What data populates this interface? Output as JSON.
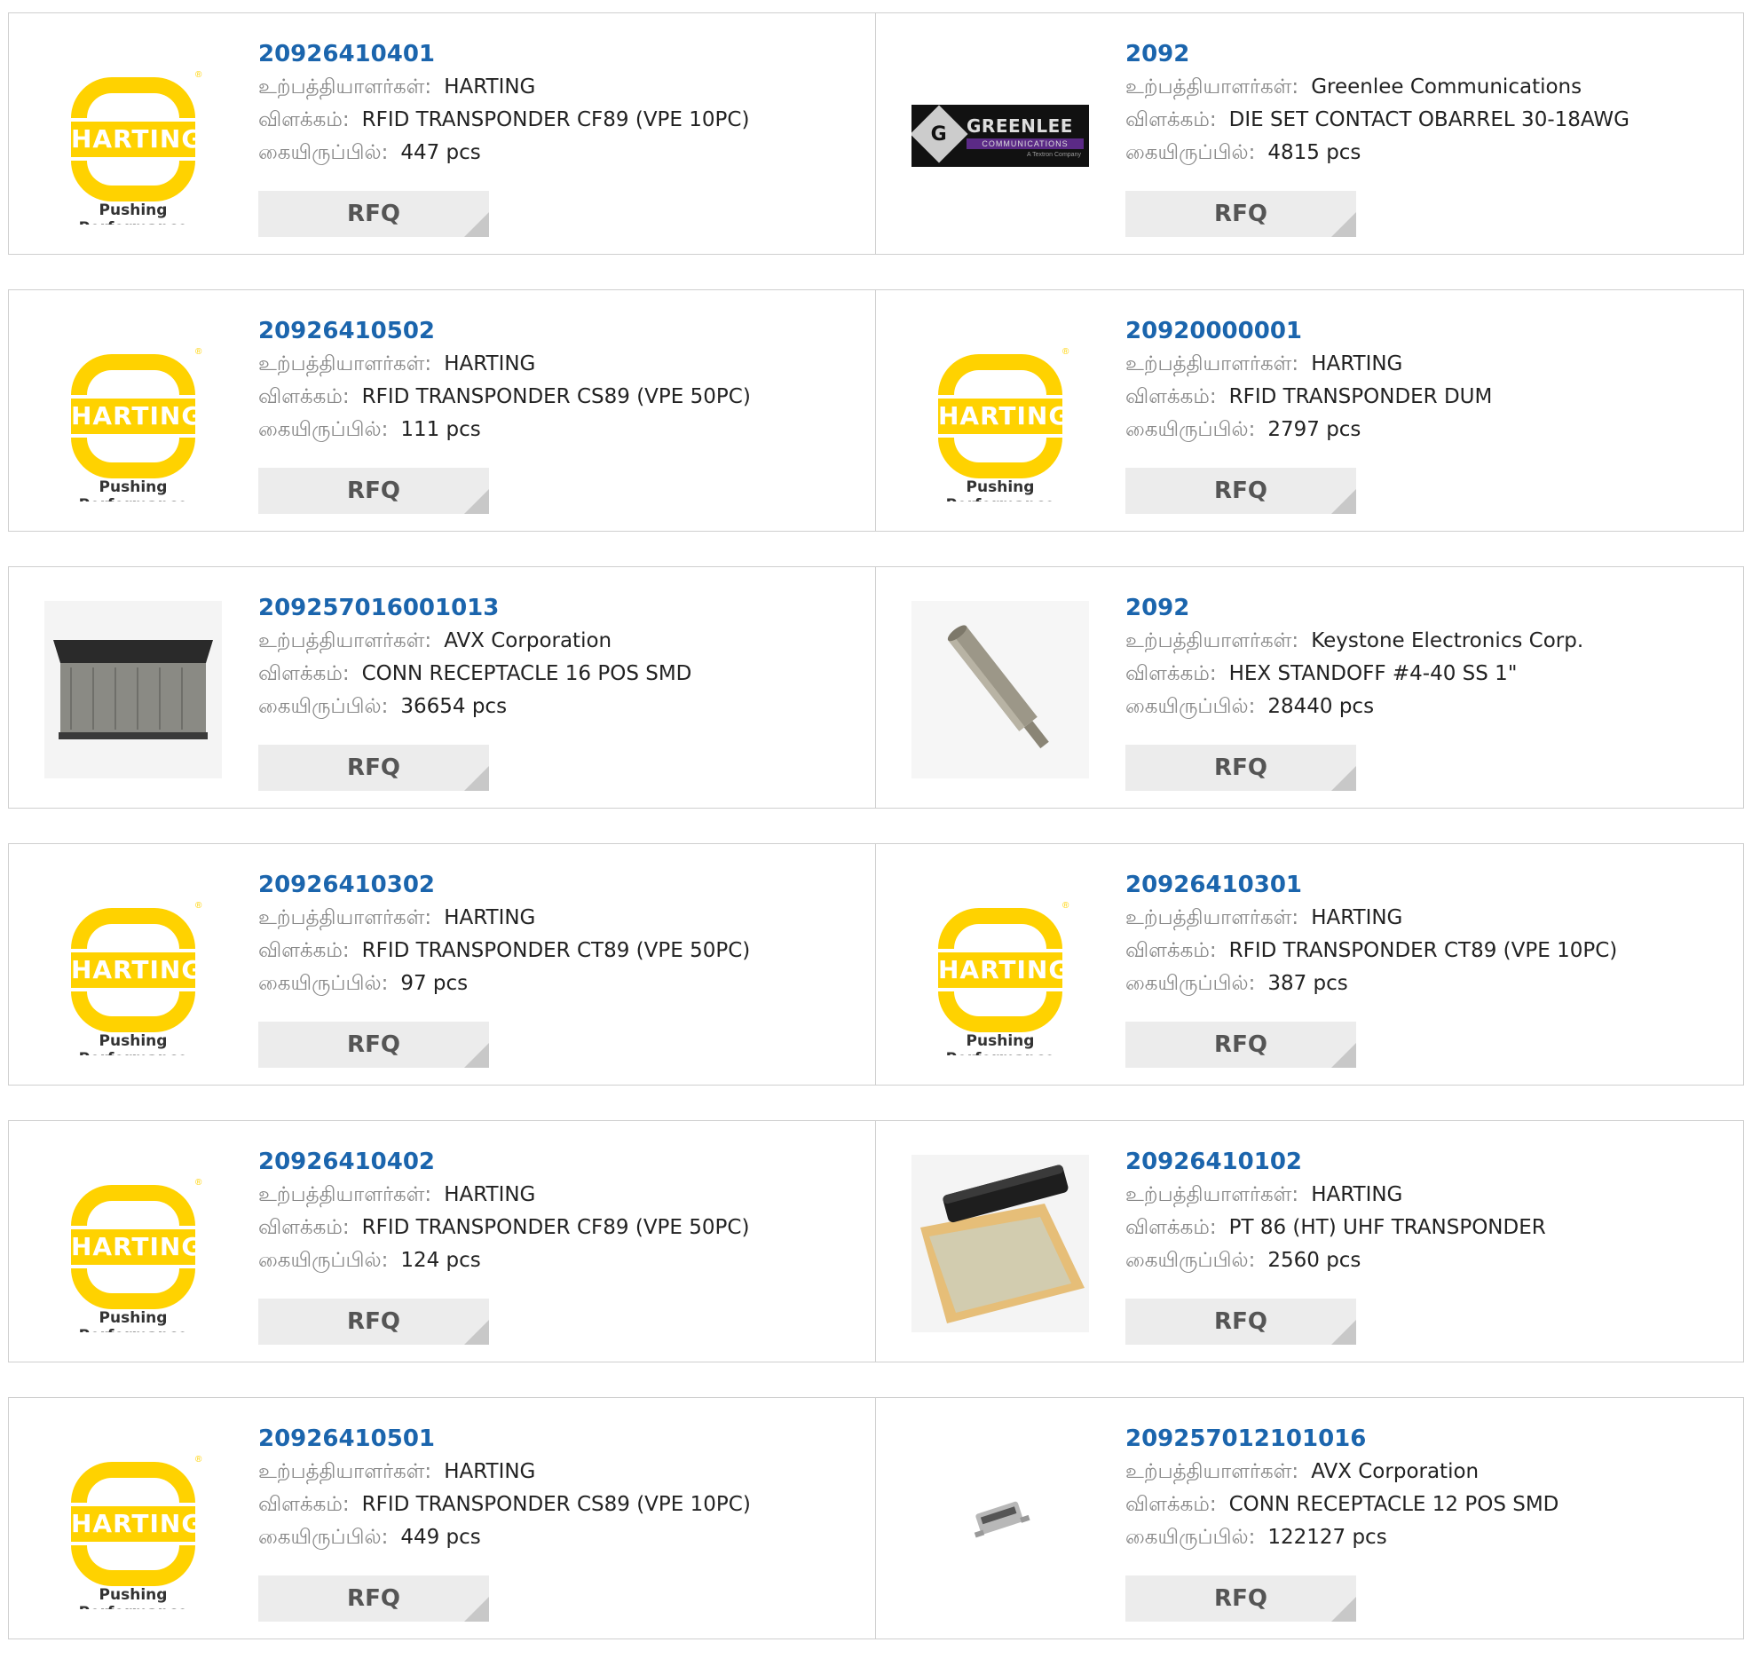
{
  "labels": {
    "manufacturer": "உற்பத்தியாளர்கள்:",
    "description": "விளக்கம்:",
    "stock": "கையிருப்பில்:",
    "rfq": "RFQ"
  },
  "logos": {
    "harting_wordmark": "HARTING",
    "harting_tagline": "Pushing Performance",
    "greenlee_wordmark": "GREENLEE",
    "greenlee_sub": "COMMUNICATIONS",
    "greenlee_letter": "G",
    "greenlee_small": "A Textron Company"
  },
  "colors": {
    "part_link": "#1b65ad",
    "harting_yellow": "#ffd200",
    "rfq_bg": "#ececec"
  },
  "products": [
    {
      "part": "20926410401",
      "manufacturer": "HARTING",
      "description": "RFID TRANSPONDER CF89 (VPE 10PC)",
      "stock": "447 pcs",
      "image": "harting-logo"
    },
    {
      "part": "2092",
      "manufacturer": "Greenlee Communications",
      "description": "DIE SET CONTACT OBARREL 30-18AWG",
      "stock": "4815 pcs",
      "image": "greenlee-logo"
    },
    {
      "part": "20926410502",
      "manufacturer": "HARTING",
      "description": "RFID TRANSPONDER CS89 (VPE 50PC)",
      "stock": "111 pcs",
      "image": "harting-logo"
    },
    {
      "part": "20920000001",
      "manufacturer": "HARTING",
      "description": "RFID TRANSPONDER DUM",
      "stock": "2797 pcs",
      "image": "harting-logo"
    },
    {
      "part": "209257016001013",
      "manufacturer": "AVX Corporation",
      "description": "CONN RECEPTACLE 16 POS SMD",
      "stock": "36654 pcs",
      "image": "connector-photo"
    },
    {
      "part": "2092",
      "manufacturer": "Keystone Electronics Corp.",
      "description": "HEX STANDOFF #4-40 SS 1\"",
      "stock": "28440 pcs",
      "image": "standoff-photo"
    },
    {
      "part": "20926410302",
      "manufacturer": "HARTING",
      "description": "RFID TRANSPONDER CT89 (VPE 50PC)",
      "stock": "97 pcs",
      "image": "harting-logo"
    },
    {
      "part": "20926410301",
      "manufacturer": "HARTING",
      "description": "RFID TRANSPONDER CT89 (VPE 10PC)",
      "stock": "387 pcs",
      "image": "harting-logo"
    },
    {
      "part": "20926410402",
      "manufacturer": "HARTING",
      "description": "RFID TRANSPONDER CF89 (VPE 50PC)",
      "stock": "124 pcs",
      "image": "harting-logo"
    },
    {
      "part": "20926410102",
      "manufacturer": "HARTING",
      "description": "PT 86 (HT) UHF TRANSPONDER",
      "stock": "2560 pcs",
      "image": "transponder-photo"
    },
    {
      "part": "20926410501",
      "manufacturer": "HARTING",
      "description": "RFID TRANSPONDER CS89 (VPE 10PC)",
      "stock": "449 pcs",
      "image": "harting-logo"
    },
    {
      "part": "209257012101016",
      "manufacturer": "AVX Corporation",
      "description": "CONN RECEPTACLE 12 POS SMD",
      "stock": "122127 pcs",
      "image": "small-connector-photo"
    }
  ]
}
